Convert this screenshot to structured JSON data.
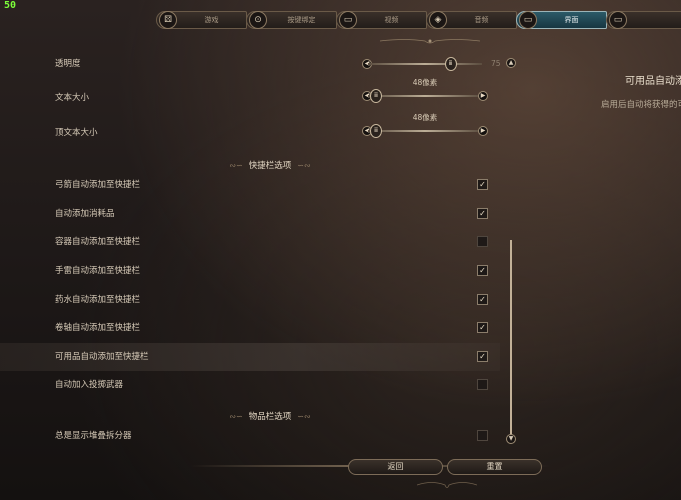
{
  "fps": "50",
  "tabs": [
    {
      "label": "游戏",
      "icon": "dice-icon",
      "active": false
    },
    {
      "label": "按键绑定",
      "icon": "controller-icon",
      "active": false
    },
    {
      "label": "视频",
      "icon": "monitor-icon",
      "active": false
    },
    {
      "label": "音频",
      "icon": "speaker-icon",
      "active": false
    },
    {
      "label": "界面",
      "icon": "interface-icon",
      "active": true
    },
    {
      "label": "",
      "icon": "monitor-icon",
      "active": false
    }
  ],
  "settings": {
    "opacity": {
      "label": "透明度",
      "value": "75",
      "level": 0.75
    },
    "text_size": {
      "label": "文本大小",
      "value": "48像素"
    },
    "overhead_text_size": {
      "label": "顶文本大小",
      "value": "48像素"
    },
    "hotbar_section": "快捷栏选项",
    "hotbar_items": [
      {
        "label": "弓箭自动添加至快捷栏",
        "checked": true
      },
      {
        "label": "自动添加消耗品",
        "checked": true
      },
      {
        "label": "容器自动添加至快捷栏",
        "checked": false
      },
      {
        "label": "手雷自动添加至快捷栏",
        "checked": true
      },
      {
        "label": "药水自动添加至快捷栏",
        "checked": true
      },
      {
        "label": "卷轴自动添加至快捷栏",
        "checked": true
      },
      {
        "label": "可用品自动添加至快捷栏",
        "checked": true
      },
      {
        "label": "自动加入投掷武器",
        "checked": false
      }
    ],
    "inventory_section": "物品栏选项",
    "inventory_items": [
      {
        "label": "总是显示堆叠拆分器",
        "checked": false
      }
    ]
  },
  "tooltip": {
    "title": "可用品自动添",
    "description": "启用后自动将获得的可"
  },
  "buttons": {
    "back": "返回",
    "reset": "重置"
  },
  "checkmark": "✓"
}
